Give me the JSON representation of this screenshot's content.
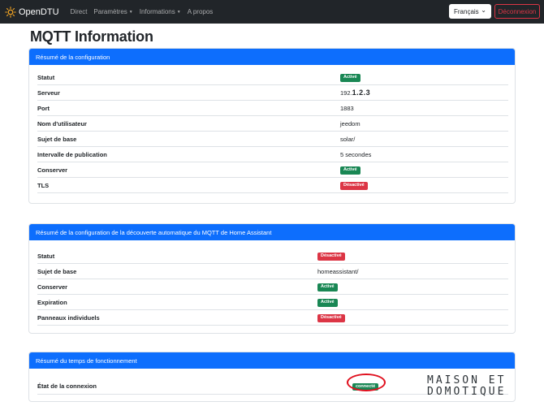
{
  "nav": {
    "brand": "OpenDTU",
    "links": [
      {
        "label": "Direct",
        "dropdown": false
      },
      {
        "label": "Paramètres",
        "dropdown": true
      },
      {
        "label": "Informations",
        "dropdown": true
      },
      {
        "label": "A propos",
        "dropdown": false
      }
    ],
    "language": "Français",
    "logout": "Déconnexion"
  },
  "page": {
    "title": "MQTT Information"
  },
  "cards": [
    {
      "header": "Résumé de la configuration",
      "rows": [
        {
          "label": "Statut",
          "value": "Activé",
          "type": "badge",
          "color": "green"
        },
        {
          "label": "Serveur",
          "value_plain": "192.",
          "value_bold": "1.2.3",
          "type": "server"
        },
        {
          "label": "Port",
          "value": "1883",
          "type": "text"
        },
        {
          "label": "Nom d'utilisateur",
          "value": "jeedom",
          "type": "text"
        },
        {
          "label": "Sujet de base",
          "value": "solar/",
          "type": "text"
        },
        {
          "label": "Intervalle de publication",
          "value": "5 secondes",
          "type": "text"
        },
        {
          "label": "Conserver",
          "value": "Activé",
          "type": "badge",
          "color": "green"
        },
        {
          "label": "TLS",
          "value": "Désactivé",
          "type": "badge",
          "color": "red"
        }
      ]
    },
    {
      "header": "Résumé de la configuration de la découverte automatique du MQTT de Home Assistant",
      "rows": [
        {
          "label": "Statut",
          "value": "Désactivé",
          "type": "badge",
          "color": "red"
        },
        {
          "label": "Sujet de base",
          "value": "homeassistant/",
          "type": "text"
        },
        {
          "label": "Conserver",
          "value": "Activé",
          "type": "badge",
          "color": "green"
        },
        {
          "label": "Expiration",
          "value": "Activé",
          "type": "badge",
          "color": "green"
        },
        {
          "label": "Panneaux individuels",
          "value": "Désactivé",
          "type": "badge",
          "color": "red"
        }
      ]
    },
    {
      "header": "Résumé du temps de fonctionnement",
      "rows": [
        {
          "label": "État de la connexion",
          "value": "connecté",
          "type": "badge",
          "color": "green"
        }
      ]
    }
  ],
  "watermark": {
    "line1": "MAISON ET",
    "line2": "DOMOTIQUE"
  },
  "colors": {
    "navbar": "#212529",
    "primary": "#0d6efd",
    "success": "#198754",
    "danger": "#dc3545",
    "highlight": "#e0101e"
  }
}
